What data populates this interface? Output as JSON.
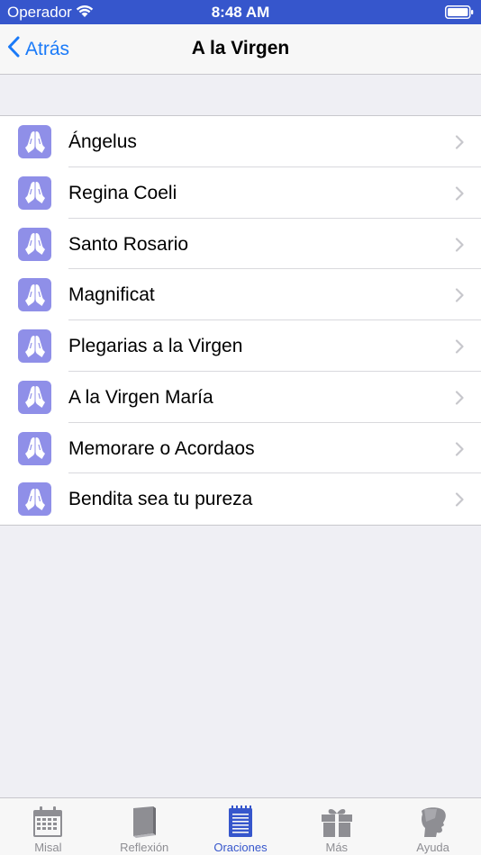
{
  "status_bar": {
    "carrier": "Operador",
    "time": "8:48 AM"
  },
  "nav": {
    "back_label": "Atrás",
    "title": "A la Virgen"
  },
  "list": {
    "icon": "praying-hands-icon",
    "items": [
      {
        "label": "Ángelus"
      },
      {
        "label": "Regina Coeli"
      },
      {
        "label": "Santo Rosario"
      },
      {
        "label": "Magnificat"
      },
      {
        "label": "Plegarias a la Virgen"
      },
      {
        "label": "A la Virgen María"
      },
      {
        "label": "Memorare o Acordaos"
      },
      {
        "label": "Bendita sea tu pureza"
      }
    ]
  },
  "tab_bar": {
    "tabs": [
      {
        "label": "Misal",
        "icon": "calendar-icon",
        "active": false
      },
      {
        "label": "Reflexión",
        "icon": "book-icon",
        "active": false
      },
      {
        "label": "Oraciones",
        "icon": "notepad-icon",
        "active": true
      },
      {
        "label": "Más",
        "icon": "gift-icon",
        "active": false
      },
      {
        "label": "Ayuda",
        "icon": "head-profile-icon",
        "active": false
      }
    ]
  },
  "colors": {
    "status_bar": "#3656cc",
    "accent": "#1a7af8",
    "active_tab": "#3656cc",
    "row_icon_bg": "#8f8fe8"
  }
}
